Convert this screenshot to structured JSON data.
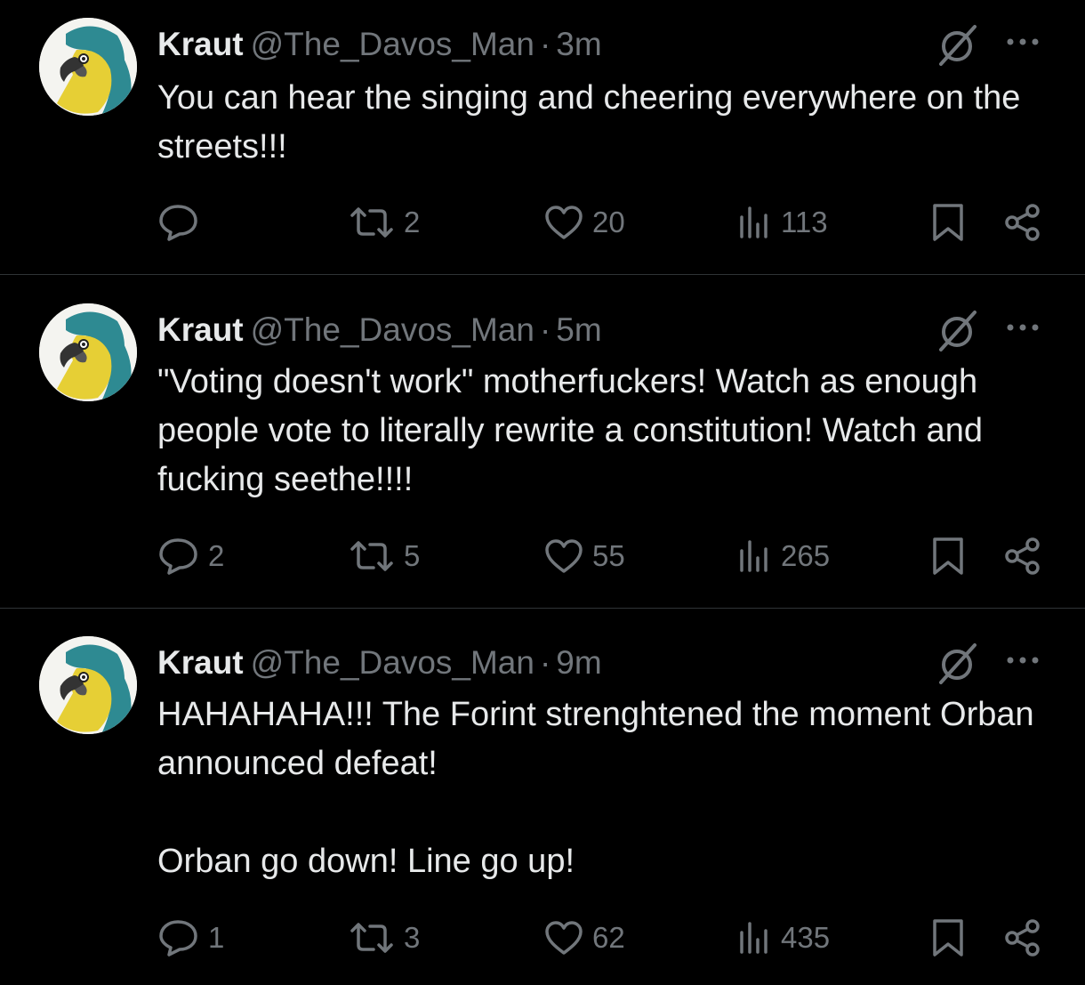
{
  "tweets": [
    {
      "author": "Kraut",
      "handle": "@The_Davos_Man",
      "separator": "·",
      "time": "3m",
      "text": "You can hear the singing and cheering everywhere on the streets!!!",
      "replies": "",
      "reposts": "2",
      "likes": "20",
      "views": "113"
    },
    {
      "author": "Kraut",
      "handle": "@The_Davos_Man",
      "separator": "·",
      "time": "5m",
      "text": "\"Voting doesn't work\" motherfuckers! Watch as enough people vote to literally rewrite a constitution! Watch and fucking seethe!!!!",
      "replies": "2",
      "reposts": "5",
      "likes": "55",
      "views": "265"
    },
    {
      "author": "Kraut",
      "handle": "@The_Davos_Man",
      "separator": "·",
      "time": "9m",
      "text_p1": "HAHAHAHA!!! The Forint strenghtened the moment Orban announced defeat!",
      "text_p2": "Orban go down! Line go up!",
      "replies": "1",
      "reposts": "3",
      "likes": "62",
      "views": "435"
    }
  ],
  "icons": {
    "avatar": "parrot-avatar-icon",
    "grok": "grok-icon",
    "more": "more-options-icon",
    "reply": "reply-icon",
    "repost": "repost-icon",
    "like": "heart-icon",
    "views": "views-icon",
    "bookmark": "bookmark-icon",
    "share": "share-icon"
  },
  "colors": {
    "background": "#000000",
    "text": "#e7e9ea",
    "muted": "#71767b",
    "divider": "#2f3336"
  }
}
